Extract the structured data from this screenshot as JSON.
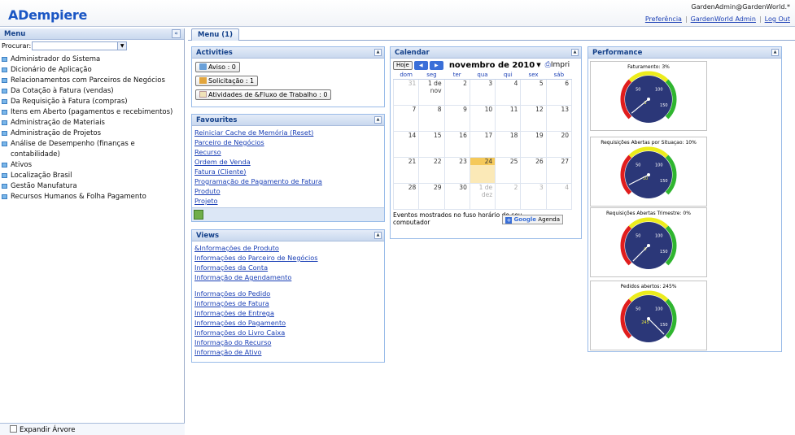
{
  "header": {
    "logo": "ADempiere",
    "user": "GardenAdmin@GardenWorld.*",
    "links": {
      "preferences": "Preferência",
      "role": "GardenWorld Admin",
      "logout": "Log Out"
    }
  },
  "left": {
    "title": "Menu",
    "collapse": "«",
    "search_label": "Procurar:",
    "search_value": "",
    "tree": [
      "Administrador do Sistema",
      "Dicionário de Aplicação",
      "Relacionamentos com Parceiros de Negócios",
      "Da Cotação à Fatura (vendas)",
      "Da Requisição à Fatura (compras)",
      "Itens em Aberto (pagamentos e recebimentos)",
      "Administração de Materiais",
      "Administração de Projetos",
      "Análise de Desempenho (finanças e contabilidade)",
      "Ativos",
      "Localização Brasil",
      "Gestão Manufatura",
      "Recursos Humanos & Folha Pagamento"
    ],
    "expand_tree": "Expandir Árvore"
  },
  "tabs": {
    "menu": "Menu (1)"
  },
  "activities": {
    "title": "Activities",
    "buttons": [
      "Aviso : 0",
      "Solicitação : 1",
      "Atividades de &Fluxo de Trabalho : 0"
    ]
  },
  "favourites": {
    "title": "Favourites",
    "items": [
      "Reiniciar Cache de Memória (Reset)",
      "Parceiro de Negócios",
      "Recurso",
      "Ordem de Venda",
      "Fatura (Cliente)",
      "Programação de Pagamento de Fatura",
      "Produto",
      "Projeto"
    ]
  },
  "views": {
    "title": "Views",
    "group1": [
      "&Informações de Produto",
      "Informações do Parceiro de Negócios",
      "Informações da Conta",
      "Informação de Agendamento"
    ],
    "group2": [
      "Informações do Pedido",
      "Informações de Fatura",
      "Informações de Entrega",
      "Informações do Pagamento",
      "Informações do Livro Caixa",
      "Informação do Recurso",
      "Informação de Ativo"
    ]
  },
  "calendar": {
    "title": "Calendar",
    "today": "Hoje",
    "month": "novembro de 2010",
    "print": "Impri",
    "weekdays": [
      "dom",
      "seg",
      "ter",
      "qua",
      "qui",
      "sex",
      "sáb"
    ],
    "weeks": [
      [
        "31",
        "1 de nov",
        "2",
        "3",
        "4",
        "5",
        "6"
      ],
      [
        "7",
        "8",
        "9",
        "10",
        "11",
        "12",
        "13"
      ],
      [
        "14",
        "15",
        "16",
        "17",
        "18",
        "19",
        "20"
      ],
      [
        "21",
        "22",
        "23",
        "24",
        "25",
        "26",
        "27"
      ],
      [
        "28",
        "29",
        "30",
        "1 de dez",
        "2",
        "3",
        "4"
      ]
    ],
    "footer": "Eventos mostrados no fuso horário do seu computador",
    "google": "Agenda"
  },
  "performance": {
    "title": "Performance",
    "gauges": [
      {
        "title": "Faturamento: 3%",
        "value": "3",
        "pct": 3
      },
      {
        "title": "Requisições Abertas por Situaçao: 10%",
        "value": "10",
        "pct": 10
      },
      {
        "title": "Requisições Abertas Trimestre: 0%",
        "value": "0",
        "pct": 0
      },
      {
        "title": "Pedidos abertos: 245%",
        "value": "245",
        "pct": 245
      }
    ],
    "scale": {
      "mid_low": "50",
      "mid_high": "100",
      "max": "150"
    },
    "colors": {
      "face": "#2b3778",
      "red": "#e01d1d",
      "yellow": "#ecec1c",
      "green": "#2fb52f"
    }
  }
}
